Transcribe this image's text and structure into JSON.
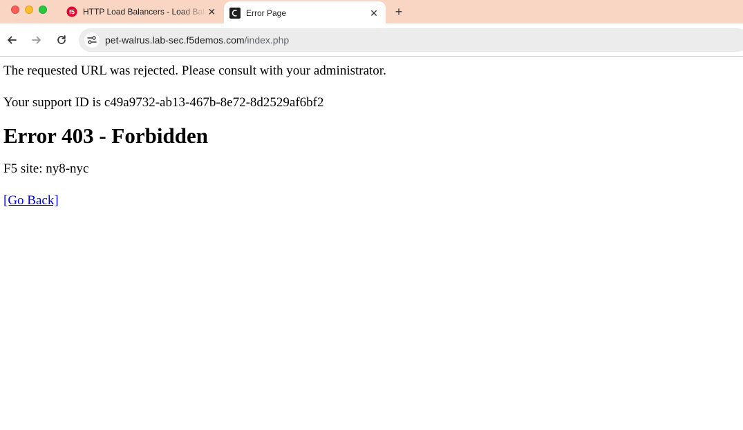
{
  "browser": {
    "tabs": [
      {
        "title": "HTTP Load Balancers - Load Balancers",
        "favicon": "f5-logo-icon",
        "active": false
      },
      {
        "title": "Error Page",
        "favicon": "page-c-icon",
        "active": true
      }
    ],
    "close_glyph": "✕",
    "newtab_glyph": "+",
    "address": {
      "host": "pet-walrus.lab-sec.f5demos.com",
      "path": "/index.php"
    },
    "icons": {
      "back": "arrow-left-icon",
      "forward": "arrow-right-icon",
      "reload": "reload-icon",
      "site_info": "tune-icon"
    },
    "colors": {
      "tabstrip": "#f9d6c4",
      "f5_red": "#e4002b"
    }
  },
  "page": {
    "rejected_message": "The requested URL was rejected. Please consult with your administrator.",
    "support_id_line": "Your support ID is c49a9732-ab13-467b-8e72-8d2529af6bf2",
    "heading": "Error 403 - Forbidden",
    "site_line": "F5 site: ny8-nyc",
    "go_back_link": "[Go Back]",
    "link_color": "#0000ee"
  }
}
